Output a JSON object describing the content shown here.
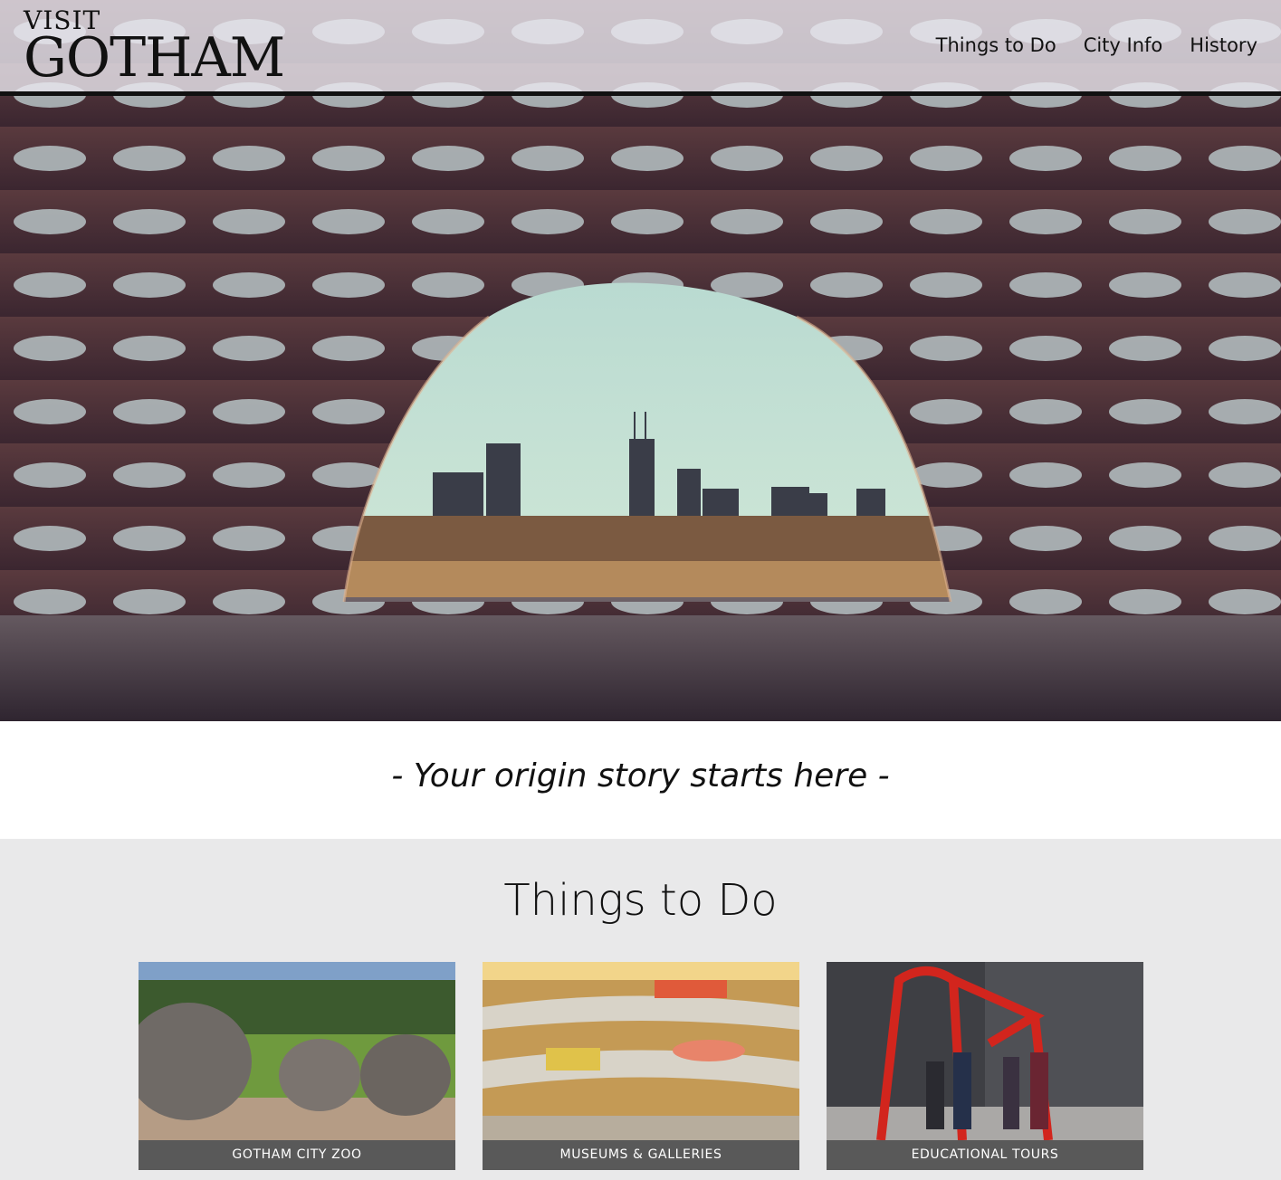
{
  "header": {
    "logo_top": "VISIT",
    "logo_main": "GOTHAM",
    "nav": [
      "Things to Do",
      "City Info",
      "History"
    ]
  },
  "hero": {
    "icon": "hero-photo-lattice-skyline"
  },
  "tagline": "- Your origin story starts here -",
  "things": {
    "title": "Things to Do",
    "cards": [
      {
        "label": "GOTHAM CITY ZOO",
        "icon": "rhinos-photo"
      },
      {
        "label": "MUSEUMS & GALLERIES",
        "icon": "museum-photo"
      },
      {
        "label": "EDUCATIONAL TOURS",
        "icon": "sculpture-tour-photo"
      }
    ]
  },
  "colors": {
    "header_bg": "#ebe8f0",
    "header_rule": "#111111",
    "section_bg": "#e9e9ea",
    "card_label_bg": "#595959"
  }
}
